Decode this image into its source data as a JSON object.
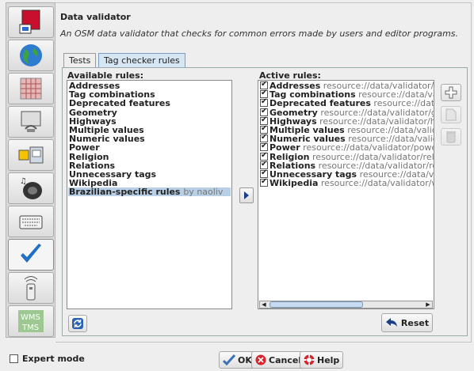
{
  "header": {
    "title": "Data validator",
    "description": "An OSM data validator that checks for common errors made by users and editor programs."
  },
  "sidebar": {
    "items": [
      {
        "icon": "display-settings-icon"
      },
      {
        "icon": "globe-icon"
      },
      {
        "icon": "map-grid-icon"
      },
      {
        "icon": "connection-icon"
      },
      {
        "icon": "plugin-icon"
      },
      {
        "icon": "audio-icon"
      },
      {
        "icon": "keyboard-icon"
      },
      {
        "icon": "validator-checkmark-icon",
        "active": true
      },
      {
        "icon": "remote-control-icon"
      },
      {
        "icon": "wms-tms-icon",
        "label": "WMS TMS"
      }
    ]
  },
  "tabs": [
    "Tests",
    "Tag checker rules"
  ],
  "available": {
    "label": "Available rules:",
    "items": [
      {
        "name": "Addresses"
      },
      {
        "name": "Tag combinations"
      },
      {
        "name": "Deprecated features"
      },
      {
        "name": "Geometry"
      },
      {
        "name": "Highways"
      },
      {
        "name": "Multiple values"
      },
      {
        "name": "Numeric values"
      },
      {
        "name": "Power"
      },
      {
        "name": "Religion"
      },
      {
        "name": "Relations"
      },
      {
        "name": "Unnecessary tags"
      },
      {
        "name": "Wikipedia"
      },
      {
        "name": "Brazilian-specific rules",
        "by": "by naoliv",
        "selected": true
      }
    ]
  },
  "active": {
    "label": "Active rules:",
    "items": [
      {
        "name": "Addresses",
        "source": "resource://data/validator/add"
      },
      {
        "name": "Tag combinations",
        "source": "resource://data/valida"
      },
      {
        "name": "Deprecated features",
        "source": "resource://data/va"
      },
      {
        "name": "Geometry",
        "source": "resource://data/validator/geon"
      },
      {
        "name": "Highways",
        "source": "resource://data/validator/highv"
      },
      {
        "name": "Multiple values",
        "source": "resource://data/validato"
      },
      {
        "name": "Numeric values",
        "source": "resource://data/validato"
      },
      {
        "name": "Power",
        "source": "resource://data/validator/power.m"
      },
      {
        "name": "Religion",
        "source": "resource://data/validator/religior"
      },
      {
        "name": "Relations",
        "source": "resource://data/validator/relati"
      },
      {
        "name": "Unnecessary tags",
        "source": "resource://data/valid"
      },
      {
        "name": "Wikipedia",
        "source": "resource://data/validator/wikip"
      }
    ]
  },
  "buttons": {
    "reset": "Reset",
    "ok": "OK",
    "cancel": "Cancel",
    "help": "Help"
  },
  "expert_mode": "Expert mode",
  "colors": {
    "selection": "#b8cfe5",
    "active_tab": "#d7e6f4",
    "checkmark_blue": "#1f6fc6"
  }
}
